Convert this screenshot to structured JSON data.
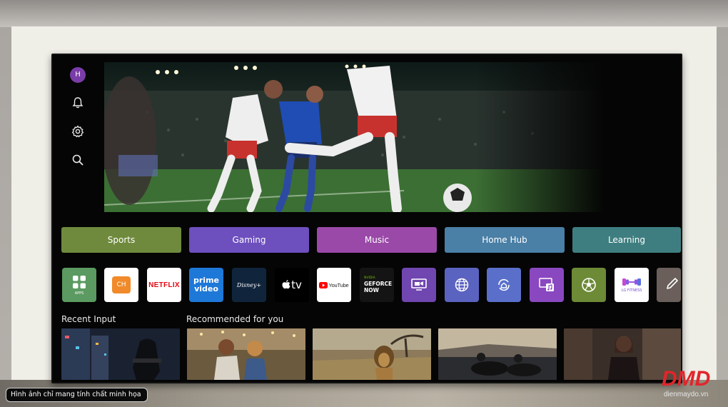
{
  "rail": {
    "avatar_initial": "H"
  },
  "categories": [
    {
      "label": "Sports",
      "color": "#6f8a3d"
    },
    {
      "label": "Gaming",
      "color": "#6d4fbd"
    },
    {
      "label": "Music",
      "color": "#9a49a8"
    },
    {
      "label": "Home Hub",
      "color": "#4a7fa6"
    },
    {
      "label": "Learning",
      "color": "#3f7e80"
    }
  ],
  "apps": {
    "apps_label": "APPS",
    "ch_label": "CH",
    "netflix_label": "NETFLIX",
    "prime_line1": "prime",
    "prime_line2": "video",
    "disney_label": "Disney+",
    "appletv_label": "tv",
    "youtube_label": "YouTube",
    "geforce_line1": "NVIDIA",
    "geforce_line2": "GEFORCE",
    "geforce_line3": "NOW",
    "lgfitness_label": "LG FITNESS"
  },
  "sections": {
    "recent_input": "Recent Input",
    "recommended": "Recommended for you"
  },
  "overlay": {
    "caption": "Hình ảnh chỉ mang tính chất minh họa",
    "watermark_site": "dienmaydo.vn"
  }
}
